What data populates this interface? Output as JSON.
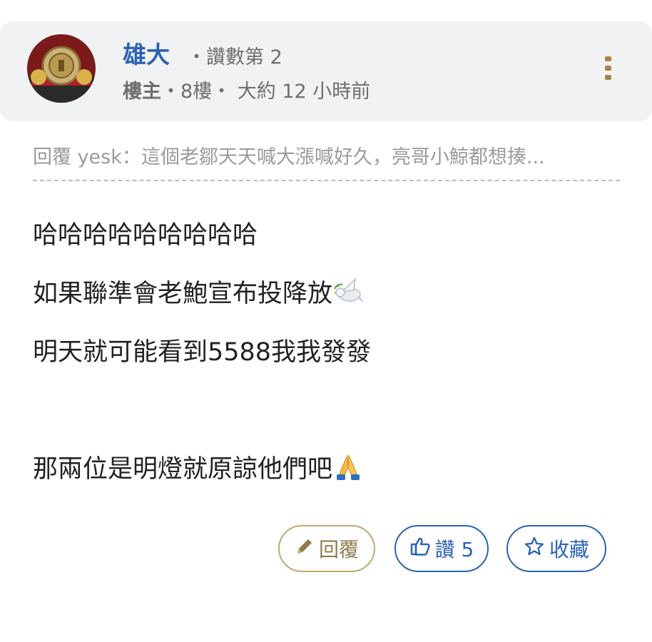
{
  "post": {
    "author": "雄大",
    "rank": "・讚數第 2",
    "op_label": "樓主",
    "floor": "・8樓・",
    "time": "大約 12 小時前",
    "quote": "回覆 yesk：這個老鄒天天喊大漲喊好久，亮哥小鯨都想揍...",
    "lines": [
      "哈哈哈哈哈哈哈哈哈",
      "如果聯準會老鮑宣布投降放",
      "明天就可能看到5588我我發發",
      "",
      "那兩位是明燈就原諒他們吧"
    ],
    "emojis": {
      "line2": "dove-icon",
      "line5": "folded-hands-icon"
    }
  },
  "actions": {
    "reply_label": "回覆",
    "like_label": "讚 5",
    "favorite_label": "收藏"
  },
  "colors": {
    "author": "#2b63b5",
    "accent_blue": "#2b63b5",
    "reply_gold": "#c2a76f",
    "header_bg": "#f1f2f3"
  }
}
